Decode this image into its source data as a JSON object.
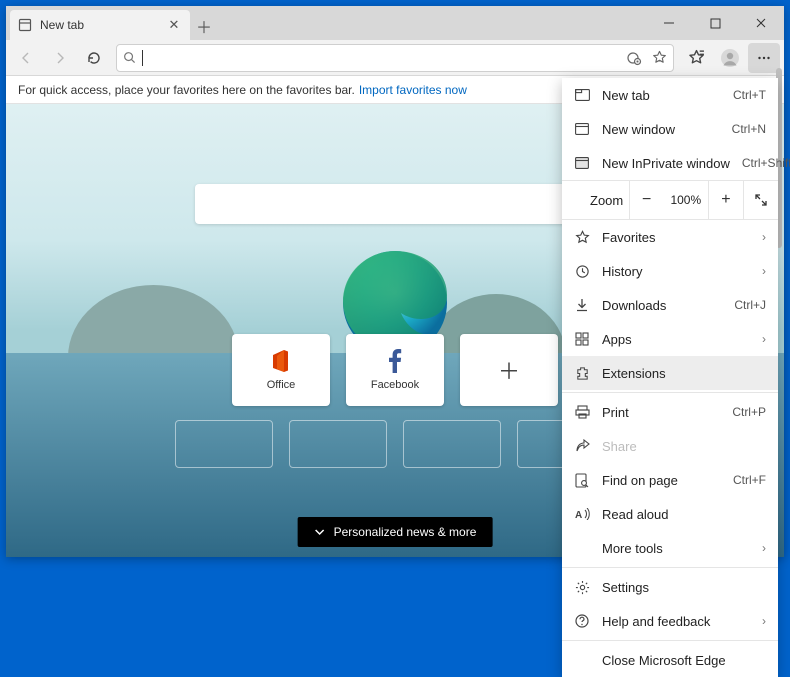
{
  "tab": {
    "title": "New tab"
  },
  "favbar": {
    "text": "For quick access, place your favorites here on the favorites bar.",
    "link": "Import favorites now"
  },
  "tiles": [
    {
      "label": "Office"
    },
    {
      "label": "Facebook"
    }
  ],
  "newspill": "Personalized news & more",
  "menu": {
    "new_tab": {
      "label": "New tab",
      "shortcut": "Ctrl+T"
    },
    "new_window": {
      "label": "New window",
      "shortcut": "Ctrl+N"
    },
    "new_inprivate": {
      "label": "New InPrivate window",
      "shortcut": "Ctrl+Shift+N"
    },
    "zoom": {
      "label": "Zoom",
      "value": "100%"
    },
    "favorites": {
      "label": "Favorites"
    },
    "history": {
      "label": "History"
    },
    "downloads": {
      "label": "Downloads",
      "shortcut": "Ctrl+J"
    },
    "apps": {
      "label": "Apps"
    },
    "extensions": {
      "label": "Extensions"
    },
    "print": {
      "label": "Print",
      "shortcut": "Ctrl+P"
    },
    "share": {
      "label": "Share"
    },
    "find": {
      "label": "Find on page",
      "shortcut": "Ctrl+F"
    },
    "read_aloud": {
      "label": "Read aloud"
    },
    "more_tools": {
      "label": "More tools"
    },
    "settings": {
      "label": "Settings"
    },
    "help": {
      "label": "Help and feedback"
    },
    "close": {
      "label": "Close Microsoft Edge"
    }
  }
}
